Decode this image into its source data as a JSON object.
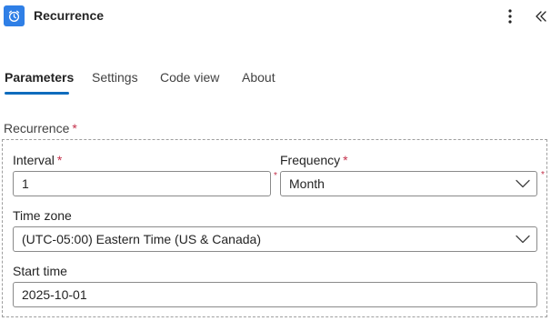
{
  "header": {
    "title": "Recurrence",
    "icon": "alarm-clock-icon",
    "accent": "#2f7fe6"
  },
  "tabs": [
    {
      "label": "Parameters",
      "active": true
    },
    {
      "label": "Settings",
      "active": false
    },
    {
      "label": "Code view",
      "active": false
    },
    {
      "label": "About",
      "active": false
    }
  ],
  "section": {
    "label": "Recurrence",
    "required_mark": "*"
  },
  "fields": {
    "interval": {
      "label": "Interval",
      "required_mark": "*",
      "value": "1"
    },
    "frequency": {
      "label": "Frequency",
      "required_mark": "*",
      "value": "Month"
    },
    "timezone": {
      "label": "Time zone",
      "value": "(UTC-05:00) Eastern Time (US & Canada)"
    },
    "start_time": {
      "label": "Start time",
      "value": "2025-10-01"
    }
  },
  "colors": {
    "tab_underline": "#0f6cbd",
    "required": "#c4314b"
  }
}
